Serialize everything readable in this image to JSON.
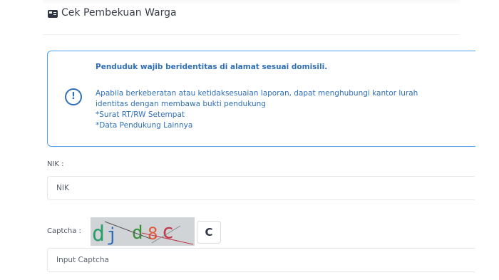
{
  "header": {
    "title": "Cek Pembekuan Warga",
    "icon": "id-card-icon"
  },
  "alert": {
    "icon": "exclamation-circle-icon",
    "heading": "Penduduk wajib beridentitas di alamat sesuai domisili.",
    "body_lines": [
      "Apabila berkeberatan atau ketidaksesuaian laporan, dapat menghubungi kantor lurah",
      "identitas dengan membawa bukti pendukung",
      "*Surat RT/RW Setempat",
      "*Data Pendukung Lainnya"
    ],
    "accent_color": "#2f6fb8",
    "border_color": "#4fa3ee"
  },
  "nik": {
    "label": "NIK :",
    "placeholder": "NIK",
    "value": ""
  },
  "captcha": {
    "label": "Captcha :",
    "image_text": "dj d8c",
    "refresh_icon": "refresh-icon",
    "refresh_glyph": "C",
    "input_placeholder": "Input Captcha",
    "input_value": ""
  }
}
